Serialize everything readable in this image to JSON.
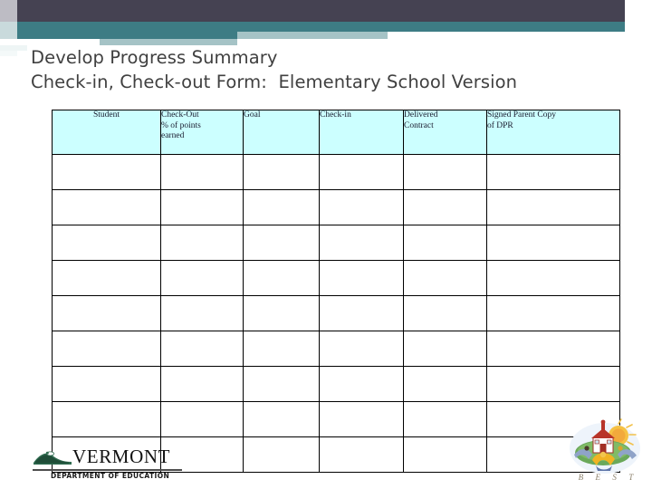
{
  "slide": {
    "title_line_1": "Develop Progress Summary",
    "title_line_2": "Check-in, Check-out Form:  Elementary School Version"
  },
  "colors": {
    "banner_dark": "#454252",
    "banner_teal": "#3d7c84",
    "banner_light": "#a5c3c6",
    "header_cell_fill": "#ccffff",
    "title_text": "#404040",
    "table_border": "#000000"
  },
  "table": {
    "columns": [
      {
        "label": "Student",
        "align": "center"
      },
      {
        "label": "Check-Out\n% of points\nearned",
        "align": "left"
      },
      {
        "label": "Goal",
        "align": "left"
      },
      {
        "label": "Check-in",
        "align": "left"
      },
      {
        "label": "Delivered\nContract",
        "align": "left"
      },
      {
        "label": "Signed Parent Copy\nof DPR",
        "align": "left"
      }
    ],
    "body_rows": 9,
    "body_cells_empty": ""
  },
  "vermont_logo": {
    "wordmark": "VERMONT",
    "subtitle": "DEPARTMENT OF EDUCATION",
    "mark_icon": "mountain-loon-icon"
  },
  "best_seal": {
    "letters": [
      "B",
      "E",
      "S",
      "T"
    ],
    "icon": "schoolhouse-children-sun-icon"
  }
}
